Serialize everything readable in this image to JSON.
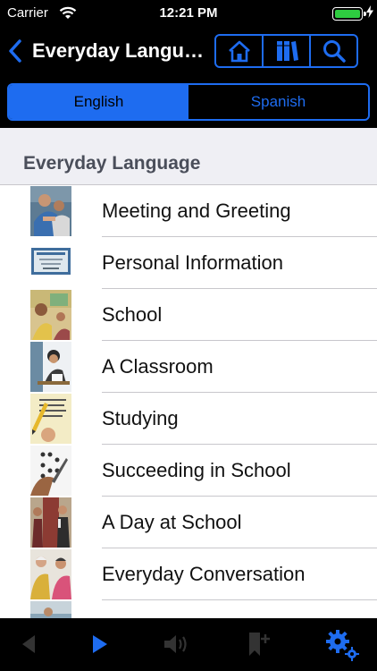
{
  "status_bar": {
    "carrier": "Carrier",
    "time": "12:21 PM",
    "battery_color": "#2ecc40"
  },
  "nav": {
    "back_icon": "chevron-left-icon",
    "title": "Everyday Language",
    "buttons": [
      "home-icon",
      "books-icon",
      "search-icon"
    ]
  },
  "segmented": {
    "options": [
      "English",
      "Spanish"
    ],
    "selected": "English"
  },
  "section": {
    "title": "Everyday Language"
  },
  "items": [
    {
      "label": "Meeting and Greeting"
    },
    {
      "label": "Personal Information"
    },
    {
      "label": "School"
    },
    {
      "label": "A Classroom"
    },
    {
      "label": "Studying"
    },
    {
      "label": "Succeeding in School"
    },
    {
      "label": "A Day at School"
    },
    {
      "label": "Everyday Conversation"
    },
    {
      "label": ""
    }
  ],
  "toolbar": {
    "icons": [
      "previous-icon",
      "play-icon",
      "speaker-icon",
      "add-bookmark-icon",
      "settings-icon"
    ]
  },
  "colors": {
    "accent": "#1e6cf0",
    "background": "#000000",
    "section_bg": "#efeff4"
  }
}
